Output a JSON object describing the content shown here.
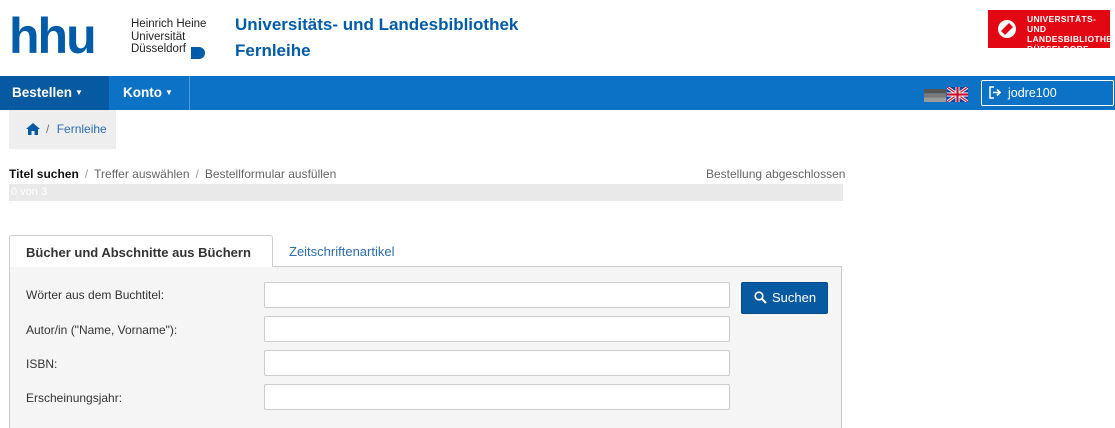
{
  "header": {
    "hhu_logo": "hhu",
    "hhu_line1": "Heinrich Heine",
    "hhu_line2": "Universität",
    "hhu_line3": "Düsseldorf",
    "title": "Universitäts- und Landesbibliothek",
    "subtitle": "Fernleihe",
    "ulb_logo": [
      "UNIVERSITÄTS- UND",
      "LANDESBIBLIOTHEK",
      "DÜSSELDORF"
    ]
  },
  "nav": {
    "items": [
      {
        "label": "Bestellen"
      },
      {
        "label": "Konto"
      }
    ],
    "logout_label": "jodre100 abmelden"
  },
  "breadcrumb": {
    "separator": "/",
    "current": "Fernleihe"
  },
  "steps": {
    "items": [
      "Titel suchen",
      "Treffer auswählen",
      "Bestellformular ausfüllen"
    ],
    "separator": "/",
    "final": "Bestellung abgeschlossen",
    "progress_label": "0 von 3",
    "progress_value": 0
  },
  "tabs": [
    {
      "label": "Bücher und Abschnitte aus Büchern",
      "active": true
    },
    {
      "label": "Zeitschriftenartikel",
      "active": false
    }
  ],
  "form": {
    "fields": [
      {
        "label": "Wörter aus dem Buchtitel:",
        "value": ""
      },
      {
        "label": "Autor/in (\"Name, Vorname\"):",
        "value": ""
      },
      {
        "label": "ISBN:",
        "value": ""
      },
      {
        "label": "Erscheinungsjahr:",
        "value": ""
      }
    ],
    "search_label": "Suchen"
  },
  "colors": {
    "brand_blue": "#005ca9",
    "nav_blue": "#0c72c6",
    "nav_active": "#0759a1",
    "ulb_red": "#e30613"
  }
}
